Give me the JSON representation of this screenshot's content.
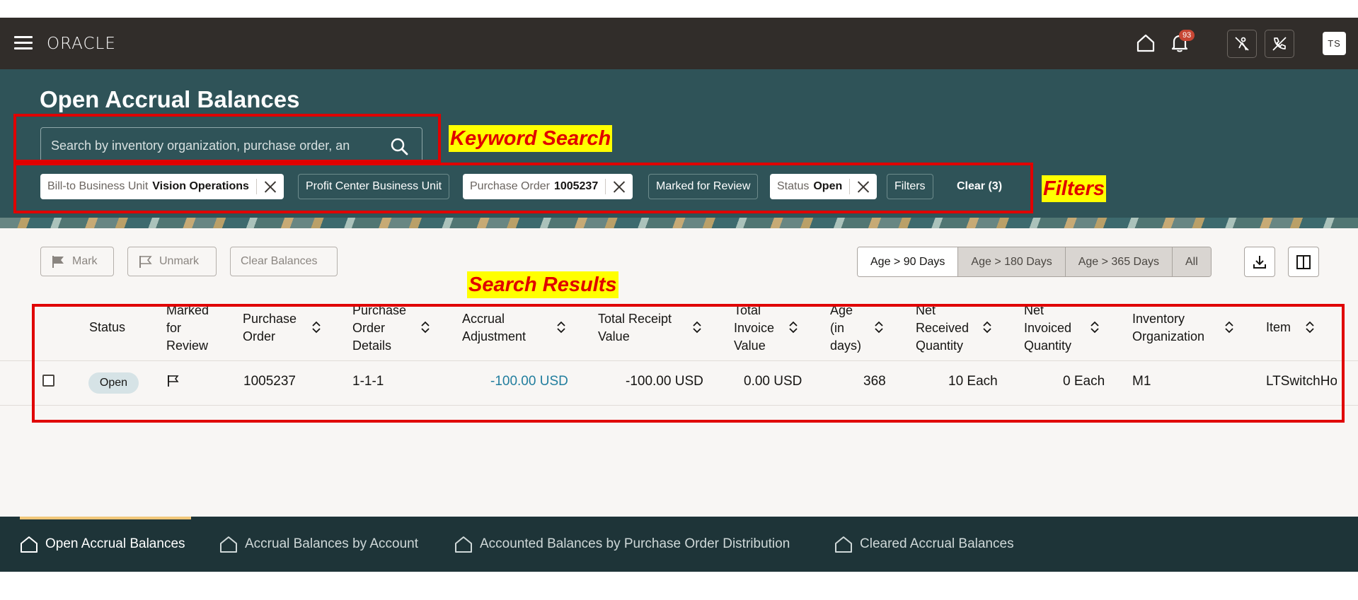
{
  "header": {
    "logo": "ORACLE",
    "notification_count": "93",
    "user_initials": "TS"
  },
  "page": {
    "title": "Open Accrual Balances"
  },
  "search": {
    "placeholder": "Search by inventory organization, purchase order, an"
  },
  "filters": {
    "chips": [
      {
        "label": "Bill-to Business Unit",
        "value": "Vision Operations"
      },
      {
        "label": "Profit Center Business Unit",
        "value": ""
      },
      {
        "label": "Purchase Order",
        "value": "1005237"
      },
      {
        "label": "Marked for Review",
        "value": ""
      },
      {
        "label": "Status",
        "value": "Open"
      },
      {
        "label": "Filters",
        "value": ""
      }
    ],
    "clear_label": "Clear (3)"
  },
  "annotations": {
    "keyword_search": "Keyword Search",
    "filters": "Filters",
    "search_results": "Search Results"
  },
  "toolbar": {
    "mark": "Mark",
    "unmark": "Unmark",
    "clear_balances": "Clear Balances",
    "age_filters": [
      "Age > 90 Days",
      "Age > 180 Days",
      "Age > 365 Days",
      "All"
    ]
  },
  "table": {
    "columns": [
      "Status",
      "Marked for Review",
      "Purchase Order",
      "Purchase Order Details",
      "Accrual Adjustment",
      "Total Receipt Value",
      "Total Invoice Value",
      "Age (in days)",
      "Net Received Quantity",
      "Net Invoiced Quantity",
      "Inventory Organization",
      "Item"
    ],
    "rows": [
      {
        "status": "Open",
        "purchase_order": "1005237",
        "po_details": "1-1-1",
        "accrual_adjustment": "-100.00 USD",
        "total_receipt_value": "-100.00 USD",
        "total_invoice_value": "0.00 USD",
        "age": "368",
        "net_received_qty": "10 Each",
        "net_invoiced_qty": "0 Each",
        "inventory_org": "M1",
        "item": "LTSwitchHo"
      }
    ]
  },
  "bottom_nav": {
    "items": [
      "Open Accrual Balances",
      "Accrual Balances by Account",
      "Accounted Balances by Purchase Order Distribution",
      "Cleared Accrual Balances"
    ]
  },
  "colors": {
    "header_bg": "#312d2a",
    "banner_bg": "#2f5358",
    "annotation_red": "#e00000",
    "annotation_yellow": "#ffff00",
    "link_teal": "#227e9e"
  }
}
